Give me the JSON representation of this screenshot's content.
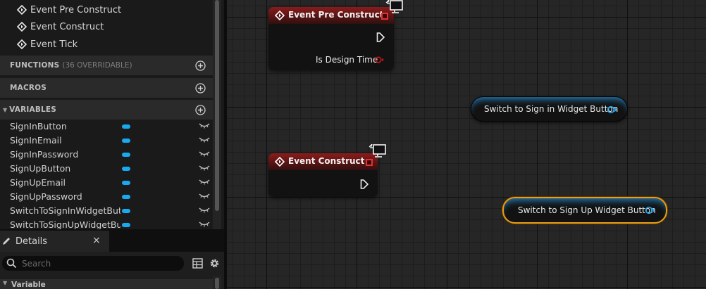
{
  "my_blueprint": {
    "events": [
      {
        "label": "Event Pre Construct",
        "icon": "event-diamond-icon"
      },
      {
        "label": "Event Construct",
        "icon": "event-diamond-icon"
      },
      {
        "label": "Event Tick",
        "icon": "event-diamond-icon"
      }
    ],
    "functions": {
      "title": "FUNCTIONS",
      "subtitle": "(36 OVERRIDABLE)"
    },
    "macros": {
      "title": "MACROS"
    },
    "variables": {
      "title": "VARIABLES",
      "pill_color": "#19a9f0",
      "items": [
        {
          "name": "SignInButton"
        },
        {
          "name": "SignInEmail"
        },
        {
          "name": "SignInPassword"
        },
        {
          "name": "SignUpButton"
        },
        {
          "name": "SignUpEmail"
        },
        {
          "name": "SignUpPassword"
        },
        {
          "name": "SwitchToSignInWidgetButton"
        },
        {
          "name": "SwitchToSignUpWidgetButton"
        }
      ]
    }
  },
  "details": {
    "tab_label": "Details",
    "close_label": "×",
    "search_placeholder": "Search",
    "category_label": "Variable"
  },
  "graph": {
    "nodes": {
      "pre_construct": {
        "title": "Event Pre Construct",
        "pin_label": "Is Design Time",
        "header_color": "#8a1c1c",
        "bool_pin_color": "#c21818"
      },
      "construct": {
        "title": "Event Construct",
        "header_color": "#8a1c1c"
      },
      "switch_sign_in": {
        "label": "Switch to Sign in Widget Button",
        "pin_color": "#2ba8f0"
      },
      "switch_sign_up": {
        "label": "Switch to Sign Up Widget Button",
        "pin_color": "#2ba8f0",
        "selected": true,
        "selection_color": "#e79d14"
      }
    }
  }
}
